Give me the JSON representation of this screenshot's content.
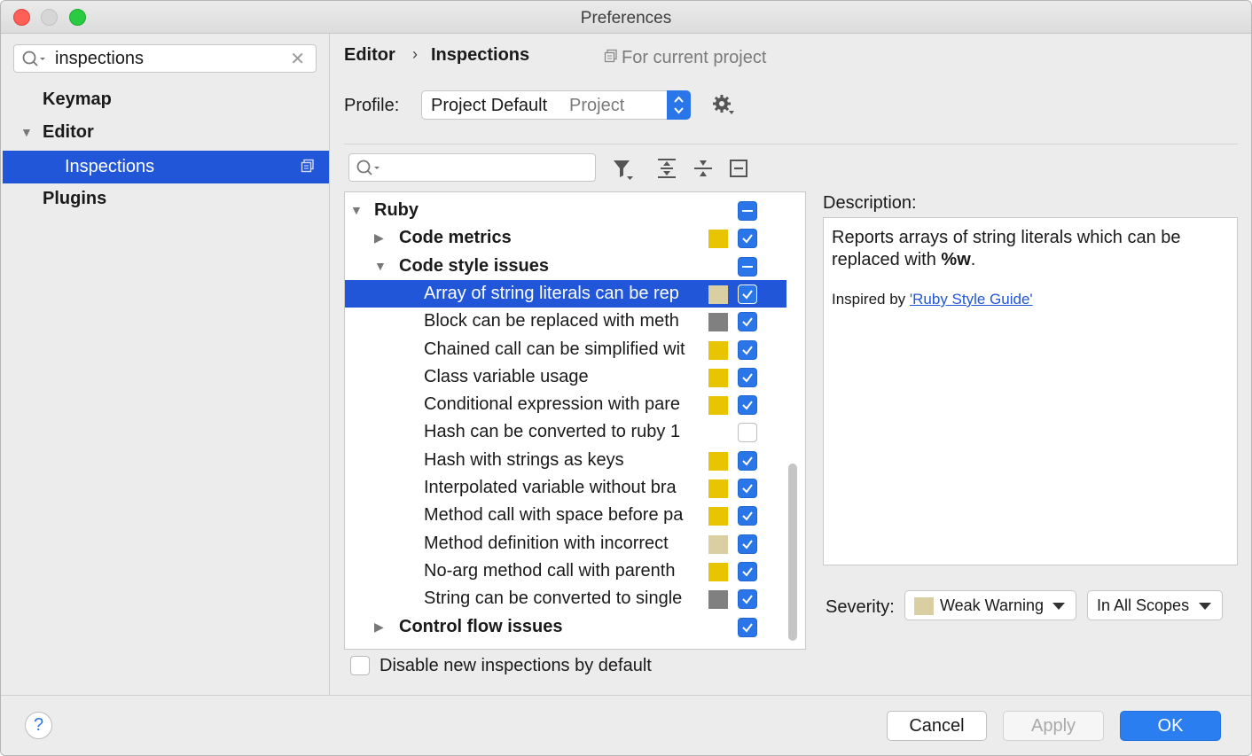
{
  "window": {
    "title": "Preferences"
  },
  "sidebar": {
    "search_value": "inspections",
    "items": [
      {
        "label": "Keymap"
      },
      {
        "label": "Editor"
      },
      {
        "label": "Inspections"
      },
      {
        "label": "Plugins"
      }
    ]
  },
  "header": {
    "breadcrumb": [
      "Editor",
      "Inspections"
    ],
    "breadcrumb_separator": "›",
    "scope_label": "For current project"
  },
  "profile": {
    "label": "Profile:",
    "name": "Project Default",
    "kind": "Project"
  },
  "tree": {
    "rows": [
      {
        "label": "Ruby",
        "level": 0,
        "expanded": true,
        "group": true,
        "checkbox": "mixed",
        "severity": null
      },
      {
        "label": "Code metrics",
        "level": 1,
        "expanded": false,
        "group": true,
        "checkbox": "on",
        "severity": "#e8c500"
      },
      {
        "label": "Code style issues",
        "level": 1,
        "expanded": true,
        "group": true,
        "checkbox": "mixed",
        "severity": null
      },
      {
        "label": "Array of string literals can be rep",
        "level": 2,
        "selected": true,
        "checkbox": "on",
        "severity": "#d9cfa2"
      },
      {
        "label": "Block can be replaced with meth",
        "level": 2,
        "checkbox": "on",
        "severity": "#808080"
      },
      {
        "label": "Chained call can be simplified wit",
        "level": 2,
        "checkbox": "on",
        "severity": "#e8c500"
      },
      {
        "label": "Class variable usage",
        "level": 2,
        "checkbox": "on",
        "severity": "#e8c500"
      },
      {
        "label": "Conditional expression with pare",
        "level": 2,
        "checkbox": "on",
        "severity": "#e8c500"
      },
      {
        "label": "Hash can be converted to ruby 1",
        "level": 2,
        "checkbox": "off",
        "severity": null
      },
      {
        "label": "Hash with strings as keys",
        "level": 2,
        "checkbox": "on",
        "severity": "#e8c500"
      },
      {
        "label": "Interpolated variable without bra",
        "level": 2,
        "checkbox": "on",
        "severity": "#e8c500"
      },
      {
        "label": "Method call with space before pa",
        "level": 2,
        "checkbox": "on",
        "severity": "#e8c500"
      },
      {
        "label": "Method definition with incorrect",
        "level": 2,
        "checkbox": "on",
        "severity": "#d9cfa2"
      },
      {
        "label": "No-arg method call with parenth",
        "level": 2,
        "checkbox": "on",
        "severity": "#e8c500"
      },
      {
        "label": "String can be converted to single",
        "level": 2,
        "checkbox": "on",
        "severity": "#808080"
      },
      {
        "label": "Control flow issues",
        "level": 1,
        "expanded": false,
        "group": true,
        "checkbox": "on",
        "severity": null
      }
    ]
  },
  "disable_new": {
    "label": "Disable new inspections by default",
    "checked": false
  },
  "description": {
    "label": "Description:",
    "text_before": "Reports arrays of string literals which can be replaced with ",
    "text_bold": "%w",
    "text_after": ".",
    "inspired_prefix": "Inspired by ",
    "inspired_link": "'Ruby Style Guide'"
  },
  "severity": {
    "label": "Severity:",
    "value": "Weak Warning",
    "color": "#d9cfa2",
    "scope": "In All Scopes"
  },
  "footer": {
    "help_label": "?",
    "cancel_label": "Cancel",
    "apply_label": "Apply",
    "ok_label": "OK"
  },
  "colors": {
    "accent": "#2a76e8",
    "selection": "#2156d8"
  }
}
